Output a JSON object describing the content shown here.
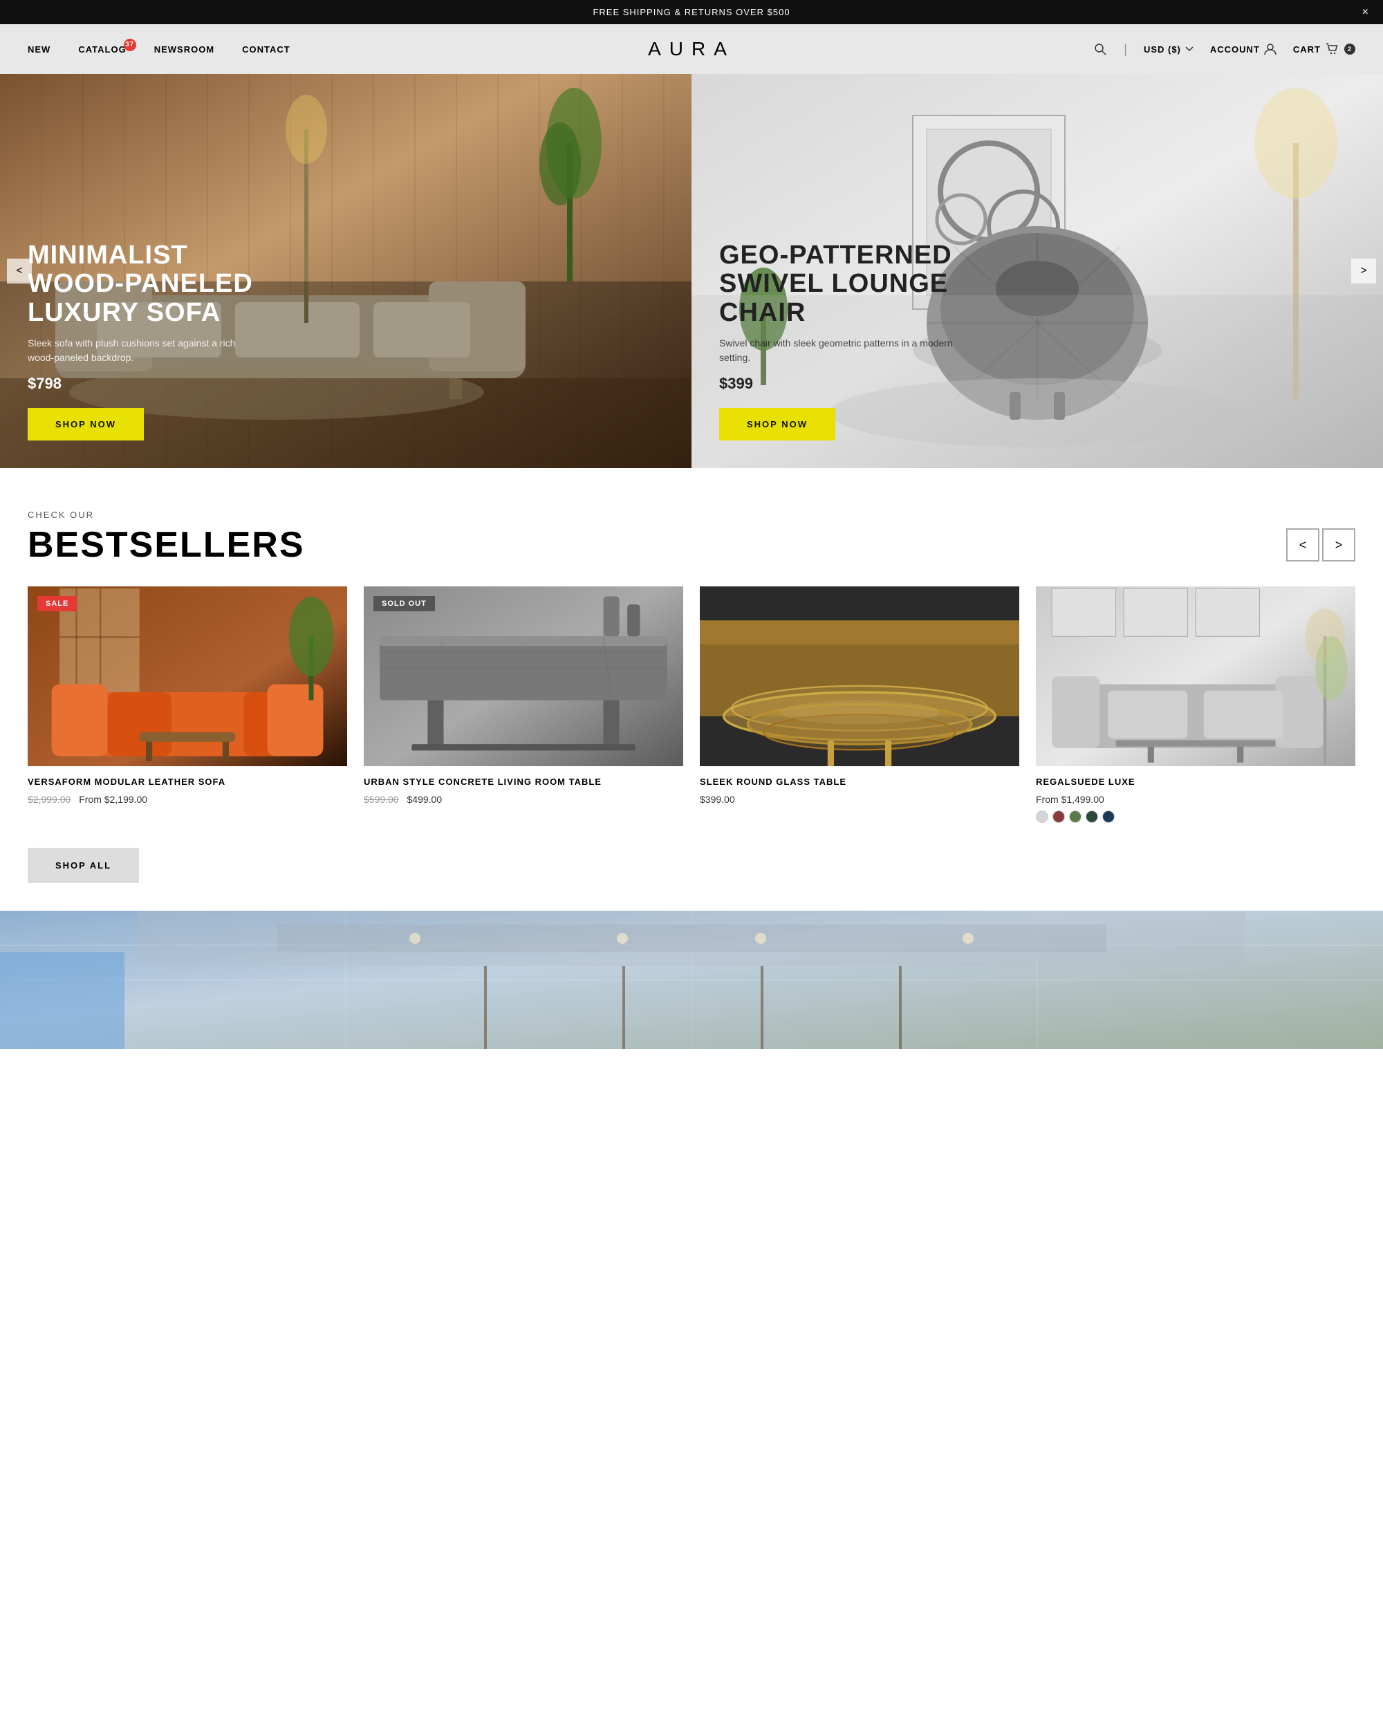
{
  "announcement": {
    "text": "FREE SHIPPING & RETURNS OVER $500",
    "close_label": "×"
  },
  "nav": {
    "left": [
      {
        "id": "new",
        "label": "NEW"
      },
      {
        "id": "catalog",
        "label": "CATALOG",
        "badge": "37"
      },
      {
        "id": "newsroom",
        "label": "NEWSROOM"
      },
      {
        "id": "contact",
        "label": "CONTACT"
      }
    ],
    "logo": "AURA",
    "right": [
      {
        "id": "search",
        "label": "",
        "icon": "search"
      },
      {
        "id": "currency",
        "label": "USD ($)"
      },
      {
        "id": "account",
        "label": "ACCOUNT",
        "icon": "user"
      },
      {
        "id": "cart",
        "label": "CART",
        "icon": "cart",
        "badge": "2"
      }
    ]
  },
  "hero": {
    "left": {
      "title": "MINIMALIST\nWOOD-PANELED\nLUXURY SOFA",
      "description": "Sleek sofa with plush cushions set against a rich wood-paneled backdrop.",
      "price": "$798",
      "cta": "SHOP NOW"
    },
    "right": {
      "title": "GEO-PATTERNED\nSWIVEL LOUNGE\nCHAIR",
      "description": "Swivel chair with sleek geometric patterns in a modern setting.",
      "price": "$399",
      "cta": "SHOP NOW"
    },
    "prev_label": "<",
    "next_label": ">"
  },
  "bestsellers": {
    "check_our": "CHECK OUR",
    "title": "BESTSELLERS",
    "prev_label": "<",
    "next_label": ">",
    "products": [
      {
        "id": "prod-1",
        "name": "VERSAFORM MODULAR LEATHER SOFA",
        "price_old": "$2,999.00",
        "price_new": "From $2,199.00",
        "badge": "SALE",
        "badge_type": "sale",
        "colors": []
      },
      {
        "id": "prod-2",
        "name": "URBAN STYLE CONCRETE LIVING ROOM TABLE",
        "price_old": "$599.00",
        "price_new": "$499.00",
        "badge": "SOLD OUT",
        "badge_type": "sold-out",
        "colors": []
      },
      {
        "id": "prod-3",
        "name": "SLEEK ROUND GLASS TABLE",
        "price_old": "",
        "price_new": "$399.00",
        "badge": "",
        "badge_type": "",
        "colors": []
      },
      {
        "id": "prod-4",
        "name": "REGALSUEDE LUXE",
        "price_old": "",
        "price_new": "From $1,499.00",
        "badge": "",
        "badge_type": "",
        "colors": [
          "#d4d4d4",
          "#8B3A3A",
          "#5a7a4a",
          "#2a4a3a",
          "#1a3a5a"
        ]
      }
    ],
    "shop_all_label": "SHOP ALL"
  }
}
